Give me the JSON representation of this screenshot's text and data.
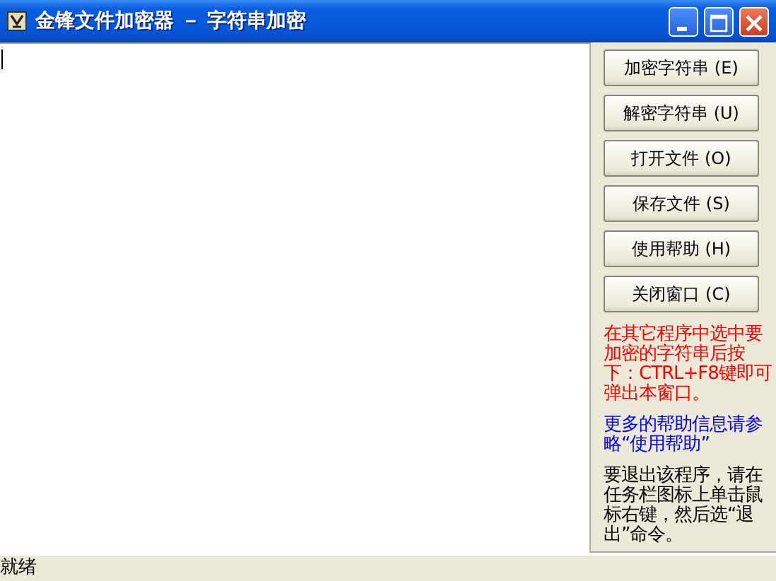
{
  "window": {
    "title": "金锋文件加密器 － 字符串加密"
  },
  "editor": {
    "focused": true
  },
  "buttons": [
    "加密字符串 (E)",
    "解密字符串 (U)",
    "打开文件 (O)",
    "保存文件 (S)",
    "使用帮助 (H)",
    "关闭窗口 (C)"
  ],
  "notes": [
    {
      "text": "在其它程序中选中要加密的字符串后按下：CTRL+F8键即可弹出本窗口。",
      "color": "#ff0000"
    },
    {
      "text": "更多的帮助信息请参略“使用帮助”",
      "color": "#0000ff"
    },
    {
      "text": "要退出该程序，请在任务栏图标上单击鼠标右键，然后选“退出”命令。",
      "color": "#000000"
    }
  ],
  "status_bar": "就绪"
}
